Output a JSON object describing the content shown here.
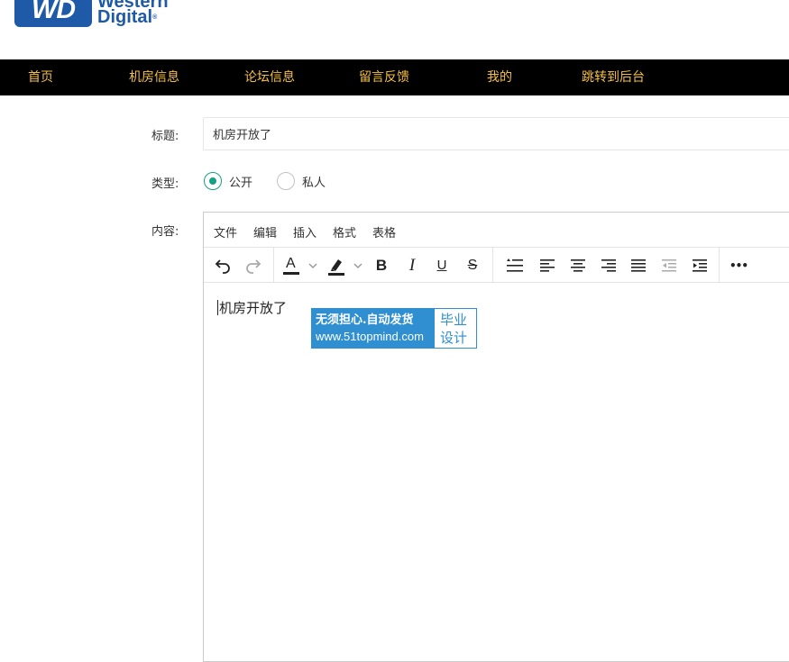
{
  "logo": {
    "mark": "WD",
    "line1": "Western",
    "line2": "Digital",
    "reg": "®"
  },
  "nav": {
    "items": [
      {
        "label": "首页"
      },
      {
        "label": "机房信息"
      },
      {
        "label": "论坛信息"
      },
      {
        "label": "留言反馈"
      },
      {
        "label": "我的"
      },
      {
        "label": "跳转到后台"
      }
    ]
  },
  "form": {
    "title_label": "标题:",
    "title_value": "机房开放了",
    "type_label": "类型:",
    "type_options": [
      {
        "label": "公开",
        "checked": true
      },
      {
        "label": "私人",
        "checked": false
      }
    ],
    "content_label": "内容:"
  },
  "editor": {
    "menu": [
      "文件",
      "编辑",
      "插入",
      "格式",
      "表格"
    ],
    "toolbar": {
      "bold": "B",
      "italic": "I",
      "underline": "U",
      "strike": "S",
      "font_color": "A",
      "more": "•••"
    },
    "content": "机房开放了"
  },
  "watermark": {
    "line1": "无须担心.自动发货",
    "line2": "www.51topmind.com",
    "right1": "毕业",
    "right2": "设计"
  },
  "colors": {
    "nav_bg": "#000000",
    "nav_text": "#f5c040",
    "radio_accent": "#16a085",
    "brand_blue": "#1e5aa8"
  }
}
